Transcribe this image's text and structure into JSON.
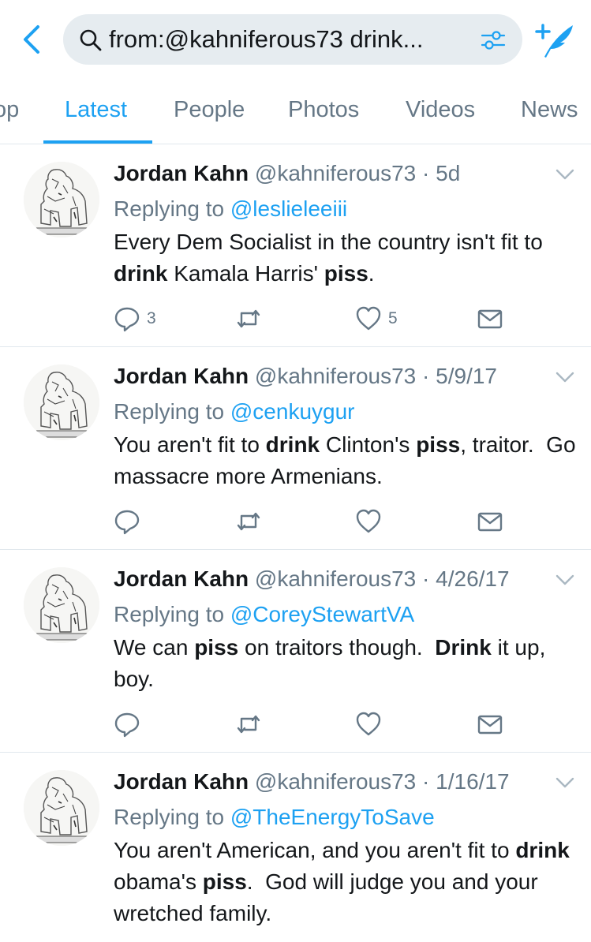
{
  "search": {
    "query": "from:@kahniferous73 drink..."
  },
  "tabs": [
    {
      "label": "op",
      "active": false
    },
    {
      "label": "Latest",
      "active": true
    },
    {
      "label": "People",
      "active": false
    },
    {
      "label": "Photos",
      "active": false
    },
    {
      "label": "Videos",
      "active": false
    },
    {
      "label": "News",
      "active": false
    }
  ],
  "colors": {
    "accent": "#1da1f2",
    "muted": "#657786",
    "divider": "#e1e8ed",
    "search_bg": "#e6ecf0"
  },
  "icons": [
    "back-chevron-icon",
    "search-icon",
    "filter-icon",
    "compose-tweet-icon",
    "caret-down-icon",
    "reply-icon",
    "retweet-icon",
    "like-icon",
    "direct-message-icon"
  ],
  "tweets": [
    {
      "name": "Jordan Kahn",
      "handle": "@kahniferous73",
      "separator": "·",
      "date": "5d",
      "replying_prefix": "Replying to",
      "replying_to": "@leslieleeiii",
      "segments": [
        {
          "t": "Every Dem Socialist in the country isn't fit to ",
          "b": false
        },
        {
          "t": "drink",
          "b": true
        },
        {
          "t": " Kamala Harris' ",
          "b": false
        },
        {
          "t": "piss",
          "b": true
        },
        {
          "t": ".",
          "b": false
        }
      ],
      "reply_count": "3",
      "retweet_count": "",
      "like_count": "5"
    },
    {
      "name": "Jordan Kahn",
      "handle": "@kahniferous73",
      "separator": "·",
      "date": "5/9/17",
      "replying_prefix": "Replying to",
      "replying_to": "@cenkuygur",
      "segments": [
        {
          "t": "You aren't fit to ",
          "b": false
        },
        {
          "t": "drink",
          "b": true
        },
        {
          "t": " Clinton's ",
          "b": false
        },
        {
          "t": "piss",
          "b": true
        },
        {
          "t": ", traitor.  Go massacre more Armenians.",
          "b": false
        }
      ],
      "reply_count": "",
      "retweet_count": "",
      "like_count": ""
    },
    {
      "name": "Jordan Kahn",
      "handle": "@kahniferous73",
      "separator": "·",
      "date": "4/26/17",
      "replying_prefix": "Replying to",
      "replying_to": "@CoreyStewartVA",
      "segments": [
        {
          "t": "We can ",
          "b": false
        },
        {
          "t": "piss",
          "b": true
        },
        {
          "t": " on traitors though.  ",
          "b": false
        },
        {
          "t": "Drink",
          "b": true
        },
        {
          "t": " it up, boy.",
          "b": false
        }
      ],
      "reply_count": "",
      "retweet_count": "",
      "like_count": ""
    },
    {
      "name": "Jordan Kahn",
      "handle": "@kahniferous73",
      "separator": "·",
      "date": "1/16/17",
      "replying_prefix": "Replying to",
      "replying_to": "@TheEnergyToSave",
      "segments": [
        {
          "t": "You aren't American, and you aren't fit to ",
          "b": false
        },
        {
          "t": "drink",
          "b": true
        },
        {
          "t": " obama's ",
          "b": false
        },
        {
          "t": "piss",
          "b": true
        },
        {
          "t": ".  God will judge you and your wretched family.",
          "b": false
        }
      ],
      "reply_count": "",
      "retweet_count": "",
      "like_count": ""
    }
  ]
}
